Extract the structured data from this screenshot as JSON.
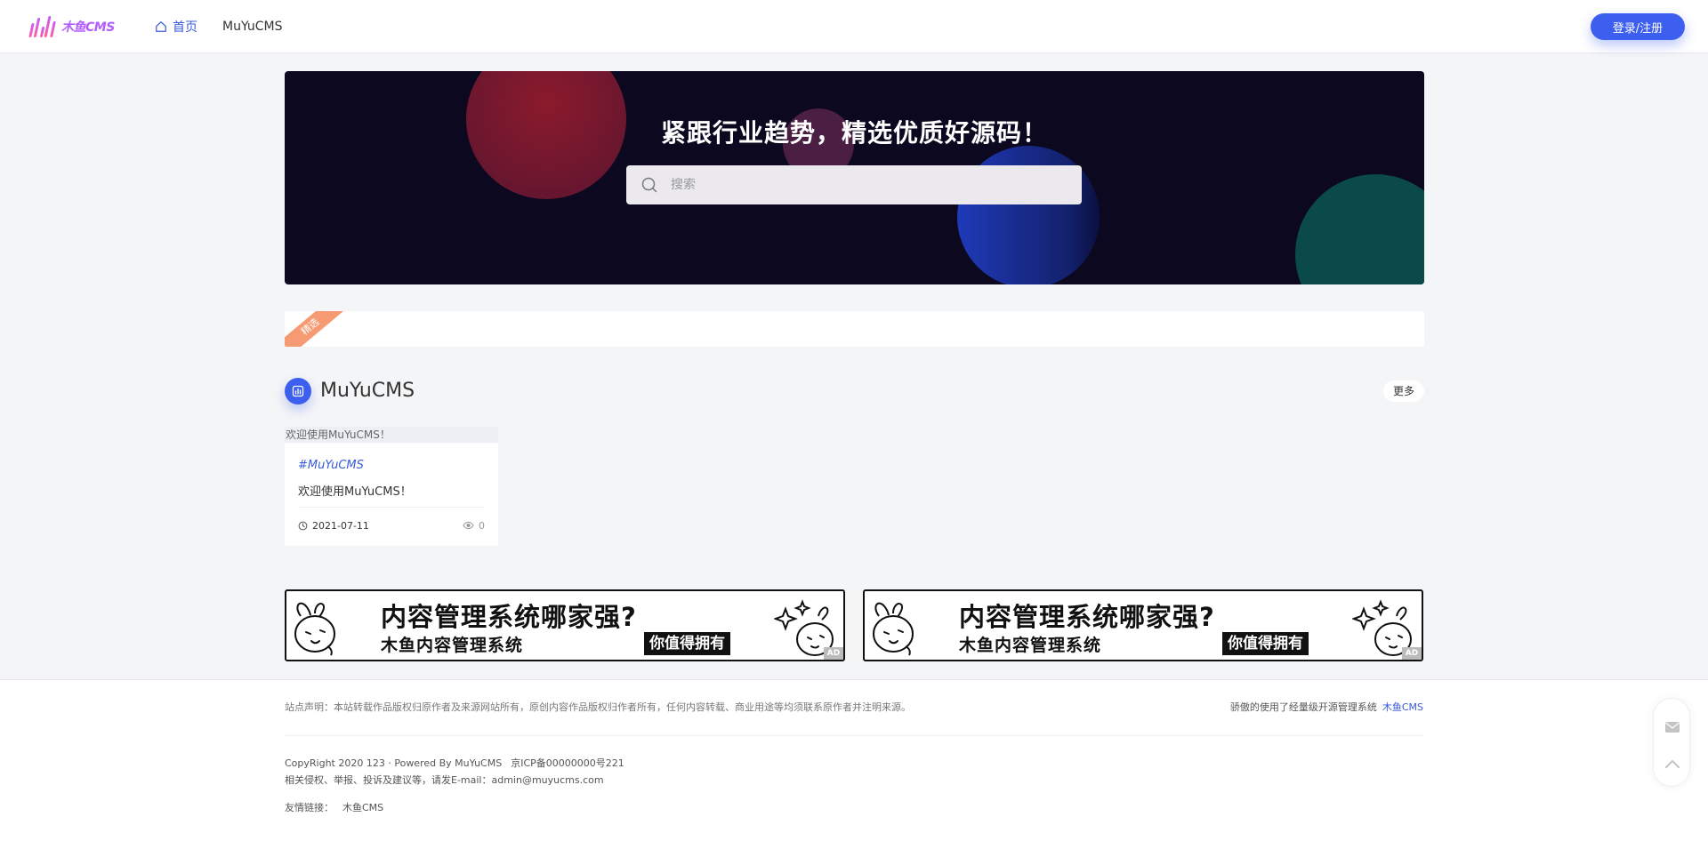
{
  "header": {
    "logo_text": "木鱼CMS",
    "nav": [
      {
        "label": "首页",
        "active": true
      },
      {
        "label": "MuYuCMS",
        "active": false
      }
    ],
    "login_label": "登录/注册"
  },
  "hero": {
    "title": "紧跟行业趋势，精选优质好源码！",
    "search_placeholder": "搜索"
  },
  "featured": {
    "ribbon_label": "精选"
  },
  "section": {
    "title": "MuYuCMS",
    "more_label": "更多"
  },
  "card": {
    "image_alt": "欢迎使用MuYuCMS！",
    "tag": "#MuYuCMS",
    "title": "欢迎使用MuYuCMS！",
    "date": "2021-07-11",
    "views": "0"
  },
  "ads": [
    {
      "main": "内容管理系统哪家强?",
      "sub": "木鱼内容管理系统",
      "tag": "你值得拥有",
      "badge": "AD"
    },
    {
      "main": "内容管理系统哪家强?",
      "sub": "木鱼内容管理系统",
      "tag": "你值得拥有",
      "badge": "AD"
    }
  ],
  "footer": {
    "declaration": "站点声明：本站转载作品版权归原作者及来源网站所有，原创内容作品版权归作者所有，任何内容转载、商业用途等均须联系原作者并注明来源。",
    "powered_text": "骄傲的使用了经量级开源管理系统",
    "powered_link": "木鱼CMS",
    "copyright": "CopyRight 2020 123 · Powered By MuYuCMS",
    "icp": "京ICP备00000000号221",
    "contact": "相关侵权、举报、投诉及建议等，请发E-mail：admin@muyucms.com",
    "links_label": "友情链接：",
    "links": [
      "木鱼CMS"
    ]
  },
  "colors": {
    "accent": "#3d5ff0",
    "hero_bg": "#0b0820",
    "ribbon": "#f59a72"
  }
}
